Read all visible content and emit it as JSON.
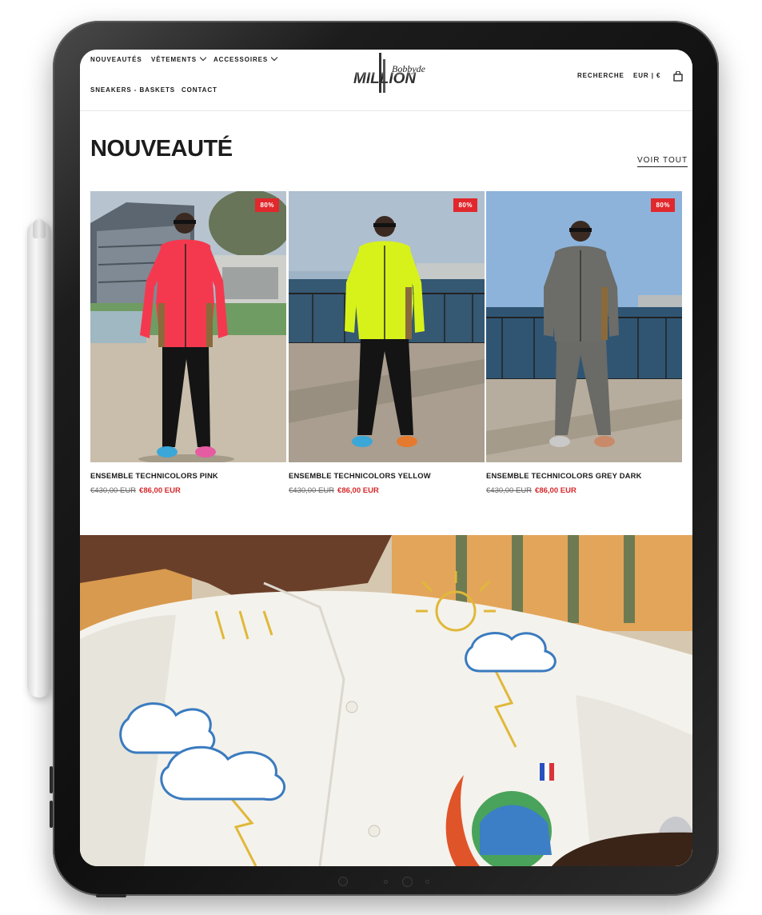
{
  "header": {
    "nav": [
      {
        "label": "NOUVEAUTÉS",
        "dropdown": false
      },
      {
        "label": "VÊTEMENTS",
        "dropdown": true
      },
      {
        "label": "ACCESSOIRES",
        "dropdown": true
      },
      {
        "label": "SNEAKERS - BASKETS",
        "dropdown": false
      },
      {
        "label": "CONTACT",
        "dropdown": false
      }
    ],
    "logo": {
      "main": "MILLION",
      "script": "Bobbyde"
    },
    "search_label": "RECHERCHE",
    "currency_label": "EUR | €",
    "cart_icon": "shopping-bag-icon"
  },
  "section": {
    "title": "NOUVEAUTÉ",
    "view_all": "VOIR TOUT"
  },
  "products": [
    {
      "title": "ENSEMBLE TECHNICOLORS PINK",
      "badge": "80%",
      "old_price": "€430,00 EUR",
      "price": "€86,00 EUR",
      "color": "#f4394f"
    },
    {
      "title": "ENSEMBLE TECHNICOLORS YELLOW",
      "badge": "80%",
      "old_price": "€430,00 EUR",
      "price": "€86,00 EUR",
      "color": "#d7f21a"
    },
    {
      "title": "ENSEMBLE TECHNICOLORS GREY DARK",
      "badge": "80%",
      "old_price": "€430,00 EUR",
      "price": "€86,00 EUR",
      "color": "#6c6c68"
    }
  ],
  "colors": {
    "sale_red": "#d6282b",
    "badge_red": "#e1282c",
    "text_dark": "#1a1a1a"
  }
}
